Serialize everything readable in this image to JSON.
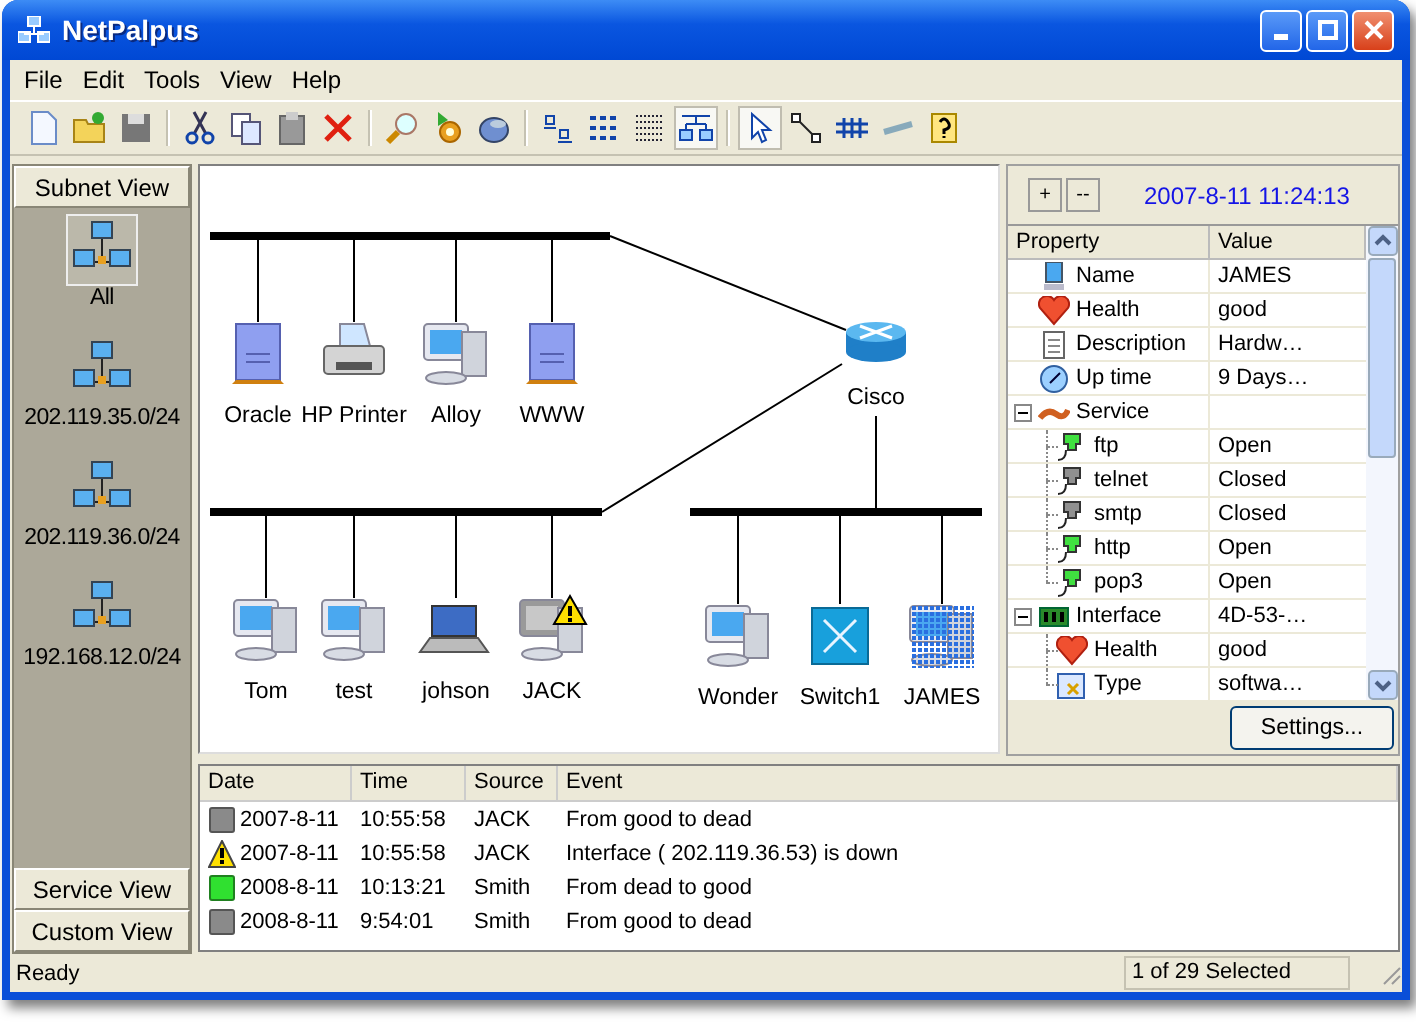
{
  "window": {
    "title": "NetPalpus"
  },
  "menu": [
    "File",
    "Edit",
    "Tools",
    "View",
    "Help"
  ],
  "toolbar": [
    [
      {
        "kind": "new",
        "selected": false
      },
      {
        "kind": "open",
        "selected": false
      },
      {
        "kind": "save",
        "selected": false
      }
    ],
    [
      {
        "kind": "cut",
        "selected": false
      },
      {
        "kind": "copy",
        "selected": false
      },
      {
        "kind": "paste",
        "selected": false
      },
      {
        "kind": "delete",
        "selected": false
      }
    ],
    [
      {
        "kind": "find",
        "selected": false
      },
      {
        "kind": "discover",
        "selected": false
      },
      {
        "kind": "database",
        "selected": false
      }
    ],
    [
      {
        "kind": "label",
        "selected": false
      },
      {
        "kind": "list",
        "selected": false
      },
      {
        "kind": "table",
        "selected": false
      },
      {
        "kind": "topology",
        "selected": true
      }
    ],
    [
      {
        "kind": "pointer",
        "selected": true
      },
      {
        "kind": "link",
        "selected": false
      },
      {
        "kind": "bus",
        "selected": false
      },
      {
        "kind": "pen",
        "selected": false
      },
      {
        "kind": "help",
        "selected": false
      }
    ]
  ],
  "left_panel": {
    "header": "Subnet View",
    "items": [
      {
        "label": "All",
        "selected": true
      },
      {
        "label": "202.119.35.0/24",
        "selected": false
      },
      {
        "label": "202.119.36.0/24",
        "selected": false
      },
      {
        "label": "192.168.12.0/24",
        "selected": false
      }
    ],
    "footer_buttons": [
      "Service View",
      "Custom View"
    ]
  },
  "network": {
    "router": {
      "name": "Cisco"
    },
    "segments": [
      {
        "nodes": [
          {
            "name": "Oracle",
            "kind": "server",
            "warning": false,
            "selected": false
          },
          {
            "name": "HP Printer",
            "kind": "printer",
            "warning": false,
            "selected": false
          },
          {
            "name": "Alloy",
            "kind": "pc",
            "warning": false,
            "selected": false
          },
          {
            "name": "WWW",
            "kind": "server",
            "warning": false,
            "selected": false
          }
        ]
      },
      {
        "nodes": [
          {
            "name": "Tom",
            "kind": "pc",
            "warning": false,
            "selected": false
          },
          {
            "name": "test",
            "kind": "pc",
            "warning": false,
            "selected": false
          },
          {
            "name": "johson",
            "kind": "laptop",
            "warning": false,
            "selected": false
          },
          {
            "name": "JACK",
            "kind": "pc",
            "warning": true,
            "selected": false
          }
        ]
      },
      {
        "nodes": [
          {
            "name": "Wonder",
            "kind": "pc",
            "warning": false,
            "selected": false
          },
          {
            "name": "Switch1",
            "kind": "switch",
            "warning": false,
            "selected": false
          },
          {
            "name": "JAMES",
            "kind": "pc",
            "warning": false,
            "selected": true
          }
        ]
      }
    ]
  },
  "properties": {
    "buttons": [
      "+",
      "--"
    ],
    "timestamp": "2007-8-11 11:24:13",
    "columns": [
      "Property",
      "Value"
    ],
    "rows": [
      {
        "kind": "device",
        "name": "Name",
        "value": "JAMES"
      },
      {
        "kind": "health",
        "name": "Health",
        "value": "good"
      },
      {
        "kind": "description",
        "name": "Description",
        "value": "Hardw…"
      },
      {
        "kind": "uptime",
        "name": "Up time",
        "value": "9 Days…"
      },
      {
        "kind": "service",
        "name": "Service",
        "expanded": true,
        "children": [
          {
            "kind": "port",
            "name": "ftp",
            "value": "Open",
            "active": true
          },
          {
            "kind": "port",
            "name": "telnet",
            "value": "Closed",
            "active": false
          },
          {
            "kind": "port",
            "name": "smtp",
            "value": "Closed",
            "active": false
          },
          {
            "kind": "port",
            "name": "http",
            "value": "Open",
            "active": true
          },
          {
            "kind": "port",
            "name": "pop3",
            "value": "Open",
            "active": true
          }
        ]
      },
      {
        "kind": "interface",
        "name": "Interface",
        "value": "4D-53-…",
        "expanded": true,
        "children": [
          {
            "kind": "health",
            "name": "Health",
            "value": "good"
          },
          {
            "kind": "type",
            "name": "Type",
            "value": "softwa…"
          }
        ]
      }
    ],
    "settings_button": "Settings..."
  },
  "event_log": {
    "columns": [
      "Date",
      "Time",
      "Source",
      "Event"
    ],
    "rows": [
      {
        "kind": "dead",
        "date": "2007-8-11",
        "time": "10:55:58",
        "source": "JACK",
        "event": "From good to dead"
      },
      {
        "kind": "warning",
        "date": "2007-8-11",
        "time": "10:55:58",
        "source": "JACK",
        "event": "Interface ( 202.119.36.53) is down"
      },
      {
        "kind": "good",
        "date": "2008-8-11",
        "time": "10:13:21",
        "source": "Smith",
        "event": "From dead to good"
      },
      {
        "kind": "dead",
        "date": "2008-8-11",
        "time": "9:54:01",
        "source": "Smith",
        "event": "From good to dead"
      }
    ]
  },
  "status_bar": {
    "text": "Ready",
    "selection": "1 of 29 Selected"
  }
}
